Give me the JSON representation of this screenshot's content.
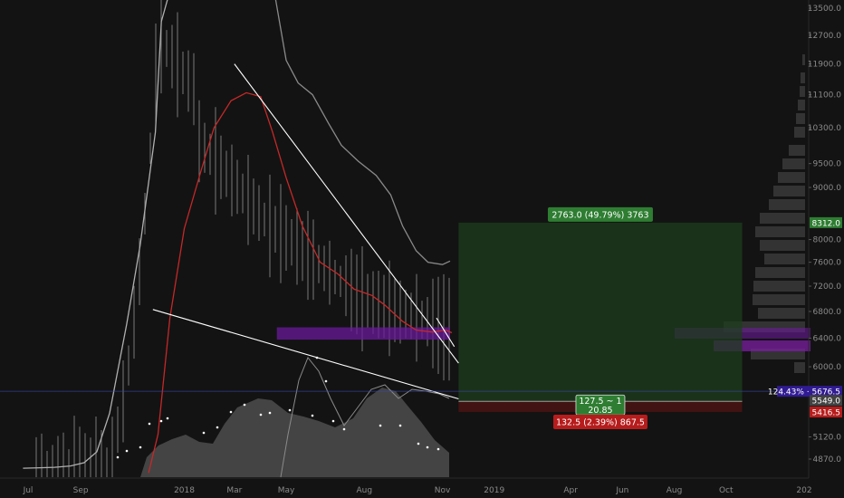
{
  "chart_data": {
    "type": "line",
    "x_axis": {
      "ticks": [
        {
          "label": "Jul",
          "date": "2017-07-01"
        },
        {
          "label": "Sep",
          "date": "2017-09-01"
        },
        {
          "label": "2018",
          "date": "2018-01-01"
        },
        {
          "label": "Mar",
          "date": "2018-03-01"
        },
        {
          "label": "May",
          "date": "2018-05-01"
        },
        {
          "label": "Aug",
          "date": "2018-08-01"
        },
        {
          "label": "Nov",
          "date": "2018-11-01"
        },
        {
          "label": "2019",
          "date": "2019-01-01"
        },
        {
          "label": "Apr",
          "date": "2019-04-01"
        },
        {
          "label": "Jun",
          "date": "2019-06-01"
        },
        {
          "label": "Aug",
          "date": "2019-08-01"
        },
        {
          "label": "Oct",
          "date": "2019-10-01"
        },
        {
          "label": "202",
          "date": "2020-01-01"
        }
      ]
    },
    "y_axis": {
      "scale": "log",
      "ticks": [
        "13500.0",
        "12700.0",
        "11900.0",
        "11100.0",
        "10300.0",
        "9500.0",
        "9000.0",
        "8000.0",
        "7600.0",
        "7200.0",
        "6800.0",
        "6400.0",
        "6000.0",
        "5120.0",
        "4870.0"
      ]
    },
    "price_badges": [
      {
        "label": "8312.0",
        "value": 8312.0,
        "color": "#2e7d32"
      },
      {
        "label": "124.43% · 5676.5",
        "value": 5676.5,
        "color": "#311b92"
      },
      {
        "label": "5549.0",
        "value": 5549.0,
        "color": "#424242"
      },
      {
        "label": "5416.5",
        "value": 5416.5,
        "color": "#b71c1c"
      }
    ],
    "position_tool": {
      "start_date": "2018-11-20",
      "end_date": "2019-10-20",
      "entry": 5549.0,
      "target": 8312.0,
      "stop": 5416.5,
      "target_label": "2763.0 (49.79%) 3763",
      "entry_label_1": "127.5 ~ 1",
      "entry_label_2": "20.85",
      "stop_label": "132.5 (2.39%) 867.5"
    },
    "series": [
      {
        "color": "#b0b0b0",
        "points": [
          [
            "2017-06-25",
            4770
          ],
          [
            "2017-07-15",
            4775
          ],
          [
            "2017-08-01",
            4780
          ],
          [
            "2017-08-20",
            4795
          ],
          [
            "2017-09-05",
            4830
          ],
          [
            "2017-09-20",
            4950
          ],
          [
            "2017-10-05",
            5400
          ],
          [
            "2017-10-25",
            6600
          ],
          [
            "2017-11-10",
            7900
          ],
          [
            "2017-11-28",
            10200
          ],
          [
            "2017-12-05",
            13100
          ],
          [
            "2017-12-18",
            15500
          ],
          [
            "2018-01-05",
            16000
          ]
        ]
      },
      {
        "color": "#c62828",
        "points": [
          [
            "2017-11-20",
            4720
          ],
          [
            "2017-12-01",
            5150
          ],
          [
            "2017-12-15",
            6700
          ],
          [
            "2018-01-01",
            8200
          ],
          [
            "2018-01-20",
            9300
          ],
          [
            "2018-02-05",
            10300
          ],
          [
            "2018-02-25",
            10950
          ],
          [
            "2018-03-15",
            11150
          ],
          [
            "2018-04-01",
            11050
          ],
          [
            "2018-04-15",
            10200
          ],
          [
            "2018-05-01",
            9200
          ],
          [
            "2018-05-20",
            8250
          ],
          [
            "2018-06-10",
            7600
          ],
          [
            "2018-07-01",
            7400
          ],
          [
            "2018-07-20",
            7150
          ],
          [
            "2018-08-10",
            7050
          ],
          [
            "2018-08-25",
            6900
          ],
          [
            "2018-09-15",
            6650
          ],
          [
            "2018-10-01",
            6520
          ],
          [
            "2018-10-20",
            6490
          ],
          [
            "2018-11-05",
            6520
          ],
          [
            "2018-11-12",
            6480
          ]
        ]
      },
      {
        "color": "#8a8a8a",
        "points": [
          [
            "2018-04-15",
            16000
          ],
          [
            "2018-05-01",
            12000
          ],
          [
            "2018-05-15",
            11400
          ],
          [
            "2018-06-01",
            11100
          ],
          [
            "2018-06-20",
            10400
          ],
          [
            "2018-07-05",
            9900
          ],
          [
            "2018-07-25",
            9550
          ],
          [
            "2018-08-15",
            9250
          ],
          [
            "2018-09-01",
            8850
          ],
          [
            "2018-09-15",
            8250
          ],
          [
            "2018-10-01",
            7800
          ],
          [
            "2018-10-15",
            7600
          ],
          [
            "2018-11-01",
            7560
          ],
          [
            "2018-11-10",
            7620
          ]
        ]
      }
    ],
    "trendlines": [
      {
        "color": "#ffffff",
        "from": [
          "2017-11-25",
          6830
        ],
        "to": [
          "2018-11-20",
          5580
        ]
      },
      {
        "color": "#ffffff",
        "from": [
          "2018-03-01",
          11900
        ],
        "to": [
          "2018-11-20",
          6050
        ]
      },
      {
        "color": "#ffffff",
        "from": [
          "2018-10-25",
          6700
        ],
        "to": [
          "2018-11-15",
          6280
        ]
      }
    ],
    "volume_profile_highlight": {
      "low": 6380,
      "high": 6560,
      "from": "2018-04-20",
      "to": "2018-11-10",
      "color": "#6a1b9a"
    }
  }
}
